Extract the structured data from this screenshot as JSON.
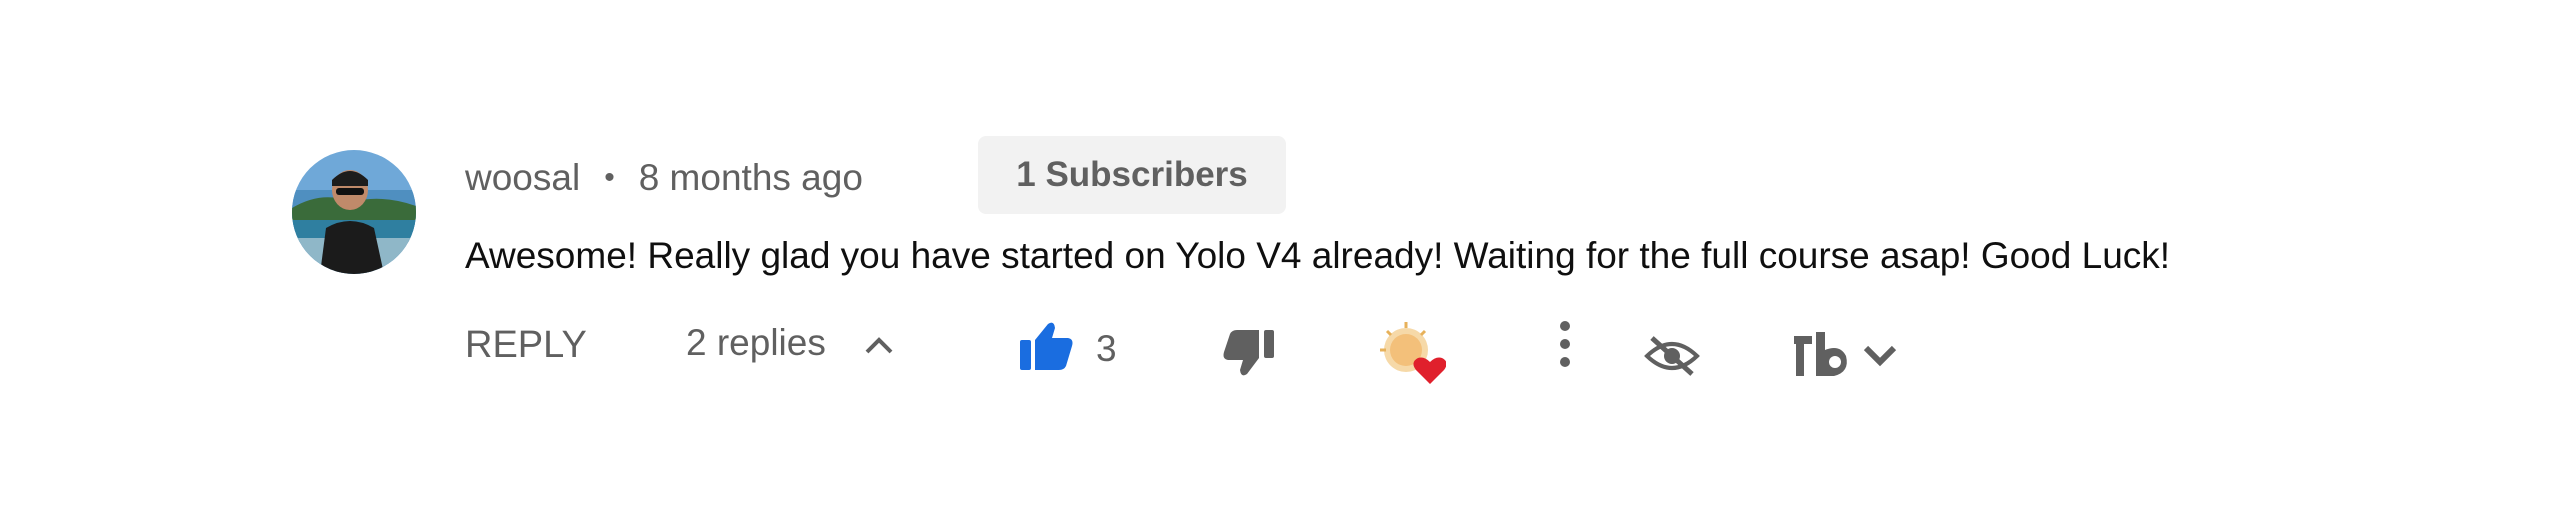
{
  "comment": {
    "author": "woosal",
    "separator": "•",
    "time": "8 months ago",
    "badge": "1 Subscribers",
    "text": "Awesome! Really glad you have started on Yolo V4 already! Waiting for the full course asap! Good Luck!"
  },
  "actions": {
    "reply_label": "REPLY",
    "replies_label": "2 replies",
    "like_count": "3"
  },
  "colors": {
    "like_blue": "#1a6de0",
    "muted": "#606060",
    "heart_red": "#e0202c"
  },
  "icons": [
    "chevron-up-icon",
    "thumbs-up-icon",
    "thumbs-down-icon",
    "creator-heart-icon",
    "more-vert-icon",
    "hide-icon",
    "tubebuddy-icon",
    "chevron-down-icon"
  ]
}
